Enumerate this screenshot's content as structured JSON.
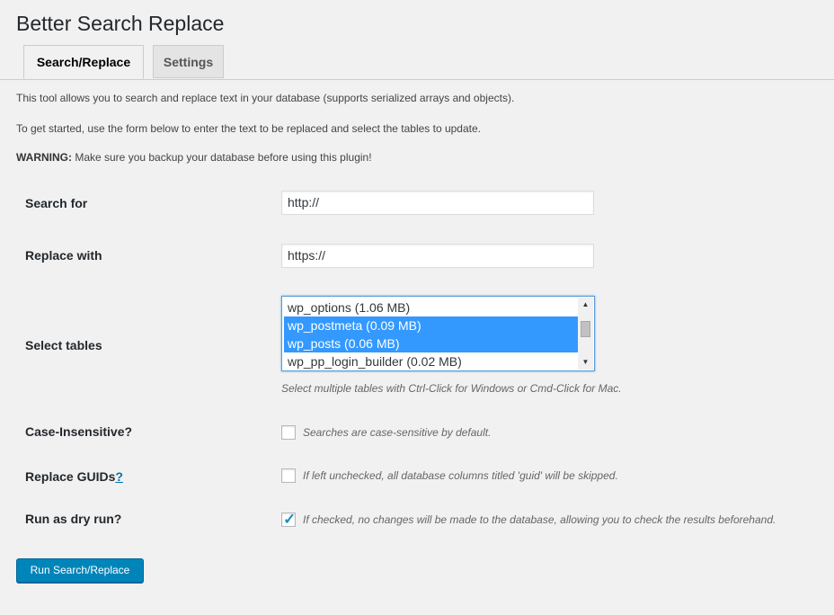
{
  "page": {
    "title": "Better Search Replace"
  },
  "tabs": [
    {
      "label": "Search/Replace",
      "active": true
    },
    {
      "label": "Settings",
      "active": false
    }
  ],
  "intro": {
    "line1": "This tool allows you to search and replace text in your database (supports serialized arrays and objects).",
    "line2": "To get started, use the form below to enter the text to be replaced and select the tables to update.",
    "warning_label": "WARNING:",
    "warning_text": " Make sure you backup your database before using this plugin!"
  },
  "form": {
    "search_for": {
      "label": "Search for",
      "value": "http://"
    },
    "replace_with": {
      "label": "Replace with",
      "value": "https://"
    },
    "select_tables": {
      "label": "Select tables",
      "options": [
        {
          "label": "wp_options (1.06 MB)",
          "selected": false
        },
        {
          "label": "wp_postmeta (0.09 MB)",
          "selected": true
        },
        {
          "label": "wp_posts (0.06 MB)",
          "selected": true
        },
        {
          "label": "wp_pp_login_builder (0.02 MB)",
          "selected": false
        }
      ],
      "help": "Select multiple tables with Ctrl-Click for Windows or Cmd-Click for Mac."
    },
    "case_insensitive": {
      "label": "Case-Insensitive?",
      "checked": false,
      "help": "Searches are case-sensitive by default."
    },
    "replace_guids": {
      "label": "Replace GUIDs",
      "help_link": "?",
      "checked": false,
      "help": "If left unchecked, all database columns titled 'guid' will be skipped."
    },
    "dry_run": {
      "label": "Run as dry run?",
      "checked": true,
      "help": "If checked, no changes will be made to the database, allowing you to check the results beforehand."
    },
    "submit_label": "Run Search/Replace"
  },
  "colors": {
    "accent": "#0085ba",
    "selection": "#3399ff",
    "checkmark": "#1e8cbe"
  },
  "icons": {
    "scroll_up": "triangle-up",
    "scroll_down": "triangle-down",
    "check": "checkmark"
  }
}
